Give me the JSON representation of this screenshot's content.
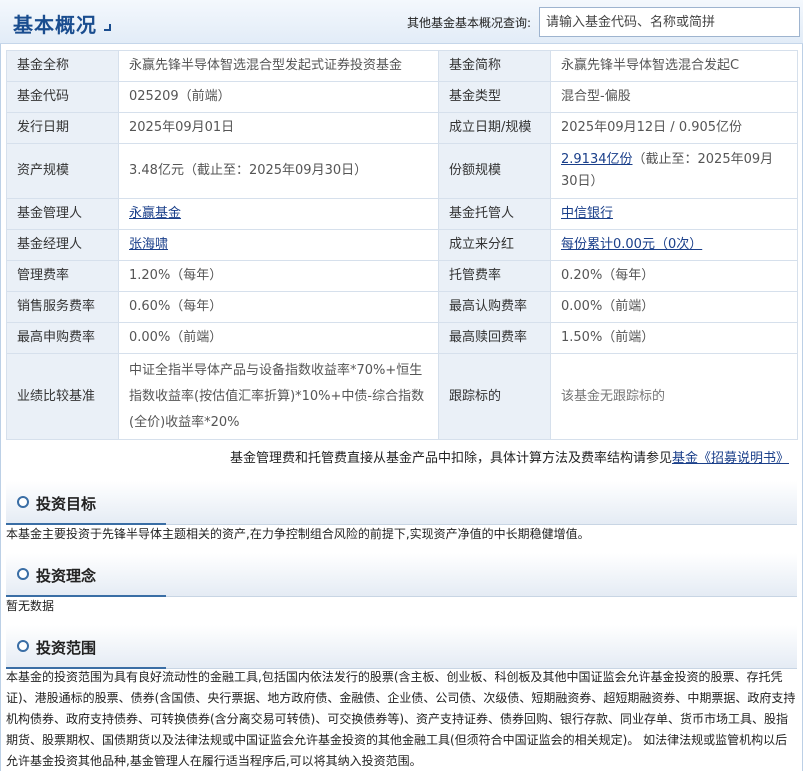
{
  "header": {
    "title": "基本概况",
    "search_label": "其他基金基本概况查询:",
    "search_placeholder": "请输入基金代码、名称或简拼"
  },
  "info": {
    "full_name_label": "基金全称",
    "full_name": "永赢先锋半导体智选混合型发起式证券投资基金",
    "short_name_label": "基金简称",
    "short_name": "永赢先锋半导体智选混合发起C",
    "code_label": "基金代码",
    "code": "025209（前端）",
    "type_label": "基金类型",
    "type": "混合型-偏股",
    "issue_date_label": "发行日期",
    "issue_date": "2025年09月01日",
    "establish_label": "成立日期/规模",
    "establish": "2025年09月12日 / 0.905亿份",
    "asset_size_label": "资产规模",
    "asset_size": "3.48亿元（截止至：2025年09月30日）",
    "share_size_label": "份额规模",
    "share_size_link": "2.9134亿份",
    "share_size_rest": "（截止至：2025年09月30日）",
    "manager_company_label": "基金管理人",
    "manager_company": "永赢基金",
    "custodian_label": "基金托管人",
    "custodian": "中信银行",
    "manager_label": "基金经理人",
    "manager": "张海啸",
    "dividend_label": "成立来分红",
    "dividend": "每份累计0.00元（0次）",
    "mgmt_fee_label": "管理费率",
    "mgmt_fee": "1.20%（每年）",
    "custody_fee_label": "托管费率",
    "custody_fee": "0.20%（每年）",
    "sales_fee_label": "销售服务费率",
    "sales_fee": "0.60%（每年）",
    "max_sub_label": "最高认购费率",
    "max_sub": "0.00%（前端）",
    "max_purchase_label": "最高申购费率",
    "max_purchase": "0.00%（前端）",
    "max_redeem_label": "最高赎回费率",
    "max_redeem": "1.50%（前端）",
    "benchmark_label": "业绩比较基准",
    "benchmark": "中证全指半导体产品与设备指数收益率*70%+恒生指数收益率(按估值汇率折算)*10%+中债-综合指数(全价)收益率*20%",
    "tracking_label": "跟踪标的",
    "tracking": "该基金无跟踪标的"
  },
  "fee_note": {
    "text": "基金管理费和托管费直接从基金产品中扣除，具体计算方法及费率结构请参见",
    "link": "基金《招募说明书》"
  },
  "sections": {
    "objective_title": "投资目标",
    "objective_text": "本基金主要投资于先锋半导体主题相关的资产,在力争控制组合风险的前提下,实现资产净值的中长期稳健增值。",
    "philosophy_title": "投资理念",
    "philosophy_text": "暂无数据",
    "scope_title": "投资范围",
    "scope_text": "本基金的投资范围为具有良好流动性的金融工具,包括国内依法发行的股票(含主板、创业板、科创板及其他中国证监会允许基金投资的股票、存托凭证)、港股通标的股票、债券(含国债、央行票据、地方政府债、金融债、企业债、公司债、次级债、短期融资券、超短期融资券、中期票据、政府支持机构债券、政府支持债券、可转换债券(含分离交易可转债)、可交换债券等)、资产支持证券、债券回购、银行存款、同业存单、货币市场工具、股指期货、股票期权、国债期货以及法律法规或中国证监会允许基金投资的其他金融工具(但须符合中国证监会的相关规定)。 如法律法规或监管机构以后允许基金投资其他品种,基金管理人在履行适当程序后,可以将其纳入投资范围。"
  }
}
